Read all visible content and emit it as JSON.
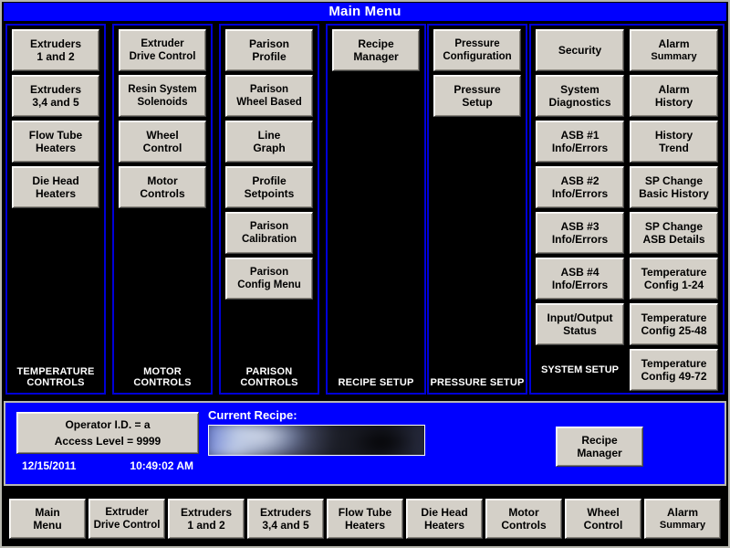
{
  "window": {
    "title": "Main Menu"
  },
  "panels": [
    {
      "id": "temperature-controls",
      "caption": "TEMPERATURE\nCONTROLS",
      "caption_line1": "TEMPERATURE",
      "caption_line2": "CONTROLS",
      "buttons": [
        {
          "line1": "Extruders",
          "line2": "1 and 2"
        },
        {
          "line1": "Extruders",
          "line2": "3,4 and 5"
        },
        {
          "line1": "Flow Tube",
          "line2": "Heaters"
        },
        {
          "line1": "Die Head",
          "line2": "Heaters"
        }
      ]
    },
    {
      "id": "motor-controls",
      "caption_line1": "MOTOR",
      "caption_line2": "CONTROLS",
      "buttons": [
        {
          "line1": "Extruder",
          "line2": "Drive Control"
        },
        {
          "line1": "Resin System",
          "line2": "Solenoids"
        },
        {
          "line1": "Wheel",
          "line2": "Control"
        },
        {
          "line1": "Motor",
          "line2": "Controls"
        }
      ]
    },
    {
      "id": "parison-controls",
      "caption_line1": "PARISON",
      "caption_line2": "CONTROLS",
      "buttons": [
        {
          "line1": "Parison",
          "line2": "Profile"
        },
        {
          "line1": "Parison",
          "line2": "Wheel Based"
        },
        {
          "line1": "Line",
          "line2": "Graph"
        },
        {
          "line1": "Profile",
          "line2": "Setpoints"
        },
        {
          "line1": "Parison",
          "line2": "Calibration"
        },
        {
          "line1": "Parison",
          "line2": "Config Menu"
        }
      ]
    },
    {
      "id": "recipe-setup",
      "caption_line1": "RECIPE",
      "caption_line2": "SETUP",
      "buttons": [
        {
          "line1": "Recipe",
          "line2": "Manager"
        }
      ]
    },
    {
      "id": "pressure-setup",
      "caption_line1": "PRESSURE",
      "caption_line2": "SETUP",
      "buttons": [
        {
          "line1": "Pressure",
          "line2": "Configuration"
        },
        {
          "line1": "Pressure",
          "line2": "Setup"
        }
      ]
    }
  ],
  "system_panel": {
    "caption_line1": "SYSTEM",
    "caption_line2": "SETUP",
    "left_column": [
      {
        "line1": "Security",
        "line2": ""
      },
      {
        "line1": "System",
        "line2": "Diagnostics"
      },
      {
        "line1": "ASB #1",
        "line2": "Info/Errors"
      },
      {
        "line1": "ASB #2",
        "line2": "Info/Errors"
      },
      {
        "line1": "ASB #3",
        "line2": "Info/Errors"
      },
      {
        "line1": "ASB #4",
        "line2": "Info/Errors"
      },
      {
        "line1": "Input/Output",
        "line2": "Status"
      }
    ],
    "right_column": [
      {
        "line1": "Alarm",
        "line2": "Summary",
        "line2_small": true
      },
      {
        "line1": "Alarm",
        "line2": "History"
      },
      {
        "line1": "History",
        "line2": "Trend"
      },
      {
        "line1": "SP Change",
        "line2": "Basic History"
      },
      {
        "line1": "SP Change",
        "line2": "ASB Details"
      },
      {
        "line1": "Temperature",
        "line2": "Config 1-24"
      },
      {
        "line1": "Temperature",
        "line2": "Config 25-48"
      },
      {
        "line1": "Temperature",
        "line2": "Config 49-72"
      }
    ]
  },
  "status": {
    "operator_id_label": "Operator I.D. =",
    "operator_id_value": "a",
    "access_level_label": "Access Level =",
    "access_level_value": "9999",
    "date": "12/15/2011",
    "time": "10:49:02 AM",
    "recipe_label": "Current Recipe:",
    "recipe_value": "",
    "recipe_manager_line1": "Recipe",
    "recipe_manager_line2": "Manager"
  },
  "nav": [
    {
      "line1": "Main",
      "line2": "Menu"
    },
    {
      "line1": "Extruder",
      "line2": "Drive Control"
    },
    {
      "line1": "Extruders",
      "line2": "1 and 2"
    },
    {
      "line1": "Extruders",
      "line2": "3,4 and 5"
    },
    {
      "line1": "Flow Tube",
      "line2": "Heaters"
    },
    {
      "line1": "Die Head",
      "line2": "Heaters"
    },
    {
      "line1": "Motor",
      "line2": "Controls"
    },
    {
      "line1": "Wheel",
      "line2": "Control"
    },
    {
      "line1": "Alarm",
      "line2": "Summary",
      "line2_small": true
    }
  ],
  "colors": {
    "accent_blue": "#0000ff",
    "panel_border": "#0000d8",
    "button_face": "#d4d0c8",
    "background": "#000000",
    "frame": "#b8b8b0"
  }
}
